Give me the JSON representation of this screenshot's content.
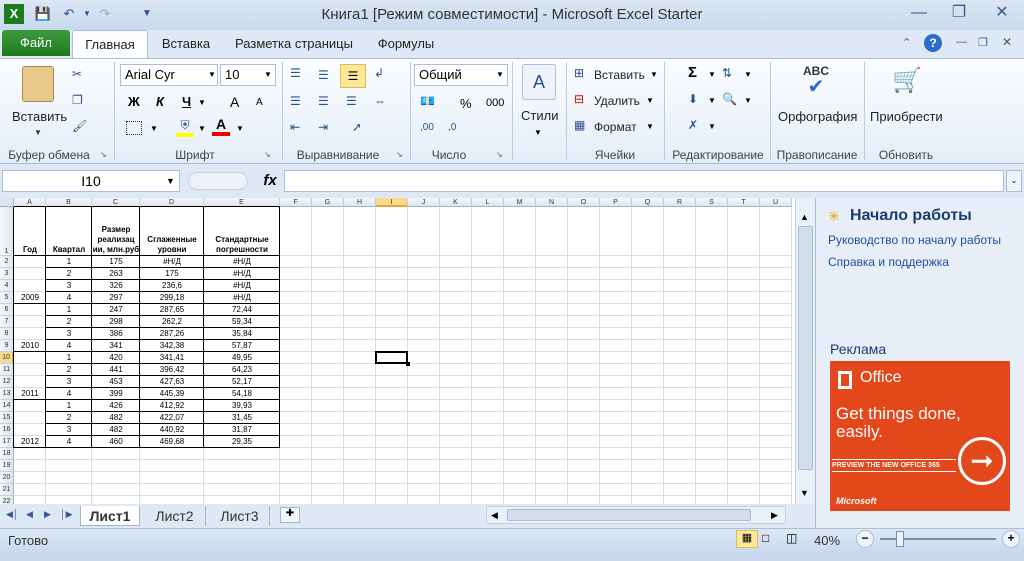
{
  "window": {
    "title": "Книга1  [Режим совместимости]  -  Microsoft Excel Starter"
  },
  "quick_access": {
    "save": "save-icon",
    "undo": "undo-icon",
    "redo": "redo-icon"
  },
  "ribbon_tabs": [
    "Файл",
    "Главная",
    "Вставка",
    "Разметка страницы",
    "Формулы"
  ],
  "groups": {
    "clipboard": {
      "label": "Буфер обмена",
      "paste": "Вставить"
    },
    "font": {
      "label": "Шрифт",
      "font_name": "Arial Cyr",
      "font_size": "10",
      "bold": "Ж",
      "italic": "К",
      "underline": "Ч",
      "grow": "A",
      "shrink": "A"
    },
    "alignment": {
      "label": "Выравнивание"
    },
    "number": {
      "label": "Число",
      "format": "Общий",
      "percent": "%",
      "thousands": "000"
    },
    "styles": {
      "label": "Стили"
    },
    "cells": {
      "label": "Ячейки",
      "insert": "Вставить",
      "delete": "Удалить",
      "format": "Формат"
    },
    "editing": {
      "label": "Редактирование"
    },
    "proofing": {
      "label": "Правописание",
      "spelling": "Орфография",
      "abc": "ABC"
    },
    "update": {
      "label": "Обновить",
      "upgrade": "Приобрести"
    }
  },
  "formula_bar": {
    "name_box": "I10",
    "fx": "fx",
    "formula": ""
  },
  "columns": [
    "A",
    "B",
    "C",
    "D",
    "E",
    "F",
    "G",
    "H",
    "I",
    "J",
    "K",
    "L",
    "M",
    "N",
    "O",
    "P",
    "Q",
    "R",
    "S",
    "T",
    "U"
  ],
  "rows": [
    "1",
    "2",
    "3",
    "4",
    "5",
    "6",
    "7",
    "8",
    "9",
    "10",
    "11",
    "12",
    "13",
    "14",
    "15",
    "16",
    "17",
    "18",
    "19",
    "20",
    "21",
    "22"
  ],
  "headers": {
    "year": "Год",
    "quarter": "Квартал",
    "size": "Размер реализац ии, млн.руб",
    "smoothed": "Сглаженные уровни",
    "errors": "Стандартные погрешности"
  },
  "years": [
    "2009",
    "2010",
    "2011",
    "2012"
  ],
  "table": [
    {
      "q": "1",
      "size": "175",
      "smooth": "#Н/Д",
      "err": "#Н/Д"
    },
    {
      "q": "2",
      "size": "263",
      "smooth": "175",
      "err": "#Н/Д"
    },
    {
      "q": "3",
      "size": "326",
      "smooth": "236,6",
      "err": "#Н/Д"
    },
    {
      "q": "4",
      "size": "297",
      "smooth": "299,18",
      "err": "#Н/Д"
    },
    {
      "q": "1",
      "size": "247",
      "smooth": "287,65",
      "err": "72,44"
    },
    {
      "q": "2",
      "size": "298",
      "smooth": "262,2",
      "err": "59,34"
    },
    {
      "q": "3",
      "size": "386",
      "smooth": "287,26",
      "err": "35,84"
    },
    {
      "q": "4",
      "size": "341",
      "smooth": "342,38",
      "err": "57,87"
    },
    {
      "q": "1",
      "size": "420",
      "smooth": "341,41",
      "err": "49,95"
    },
    {
      "q": "2",
      "size": "441",
      "smooth": "396,42",
      "err": "64,23"
    },
    {
      "q": "3",
      "size": "453",
      "smooth": "427,63",
      "err": "52,17"
    },
    {
      "q": "4",
      "size": "399",
      "smooth": "445,39",
      "err": "54,18"
    },
    {
      "q": "1",
      "size": "426",
      "smooth": "412,92",
      "err": "39,93"
    },
    {
      "q": "2",
      "size": "482",
      "smooth": "422,07",
      "err": "31,45"
    },
    {
      "q": "3",
      "size": "482",
      "smooth": "440,92",
      "err": "31,87"
    },
    {
      "q": "4",
      "size": "460",
      "smooth": "469,68",
      "err": "29,35"
    }
  ],
  "sheet_tabs": [
    "Лист1",
    "Лист2",
    "Лист3"
  ],
  "status": {
    "ready": "Готово",
    "zoom": "40%"
  },
  "task_pane": {
    "title": "Начало работы",
    "links": [
      "Руководство по началу работы",
      "Справка и поддержка"
    ],
    "ad_label": "Реклама"
  },
  "ad": {
    "brand": "Office",
    "headline": "Get things done, easily.",
    "cta": "PREVIEW THE NEW OFFICE 365",
    "footer": "Microsoft",
    "color": "#e3481b"
  }
}
